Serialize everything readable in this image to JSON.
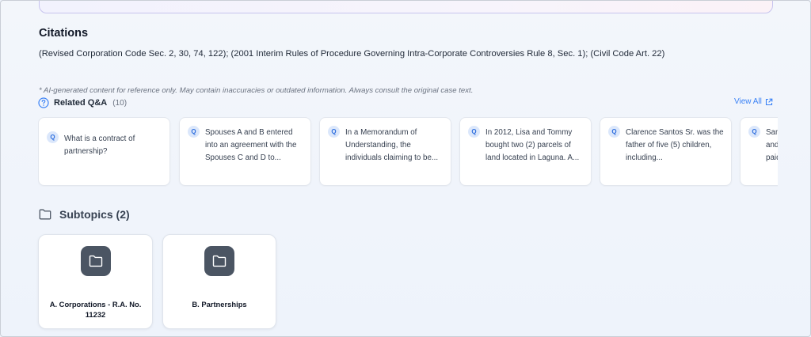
{
  "citations": {
    "heading": "Citations",
    "text": "(Revised Corporation Code Sec. 2, 30, 74, 122); (2001 Interim Rules of Procedure Governing Intra-Corporate Controversies Rule 8, Sec. 1); (Civil Code Art. 22)"
  },
  "disclaimer": "* AI-generated content for reference only. May contain inaccuracies or outdated information. Always consult the original case text.",
  "related_qa": {
    "title": "Related Q&A",
    "count": "(10)",
    "view_all_label": "View All",
    "badge": "Q",
    "items": [
      {
        "text": "What is a contract of partnership?"
      },
      {
        "text": "Spouses A and B entered into an agreement with the Spouses C and D to..."
      },
      {
        "text": "In a Memorandum of Understanding, the individuals claiming to be..."
      },
      {
        "text": "In 2012, Lisa and Tommy bought two (2) parcels of land located in Laguna. A..."
      },
      {
        "text": "Clarence Santos Sr. was the father of five (5) children, including..."
      },
      {
        "text": "San and paid"
      }
    ]
  },
  "subtopics": {
    "title": "Subtopics (2)",
    "items": [
      {
        "label": "A. Corporations - R.A. No. 11232"
      },
      {
        "label": "B. Partnerships"
      }
    ]
  },
  "colors": {
    "accent": "#3b82f6",
    "badge_bg": "#dbe7fb",
    "folder_tile": "#4b5563"
  },
  "icons": {
    "help": "question-circle-icon",
    "external": "external-link-icon",
    "folder": "folder-icon"
  }
}
